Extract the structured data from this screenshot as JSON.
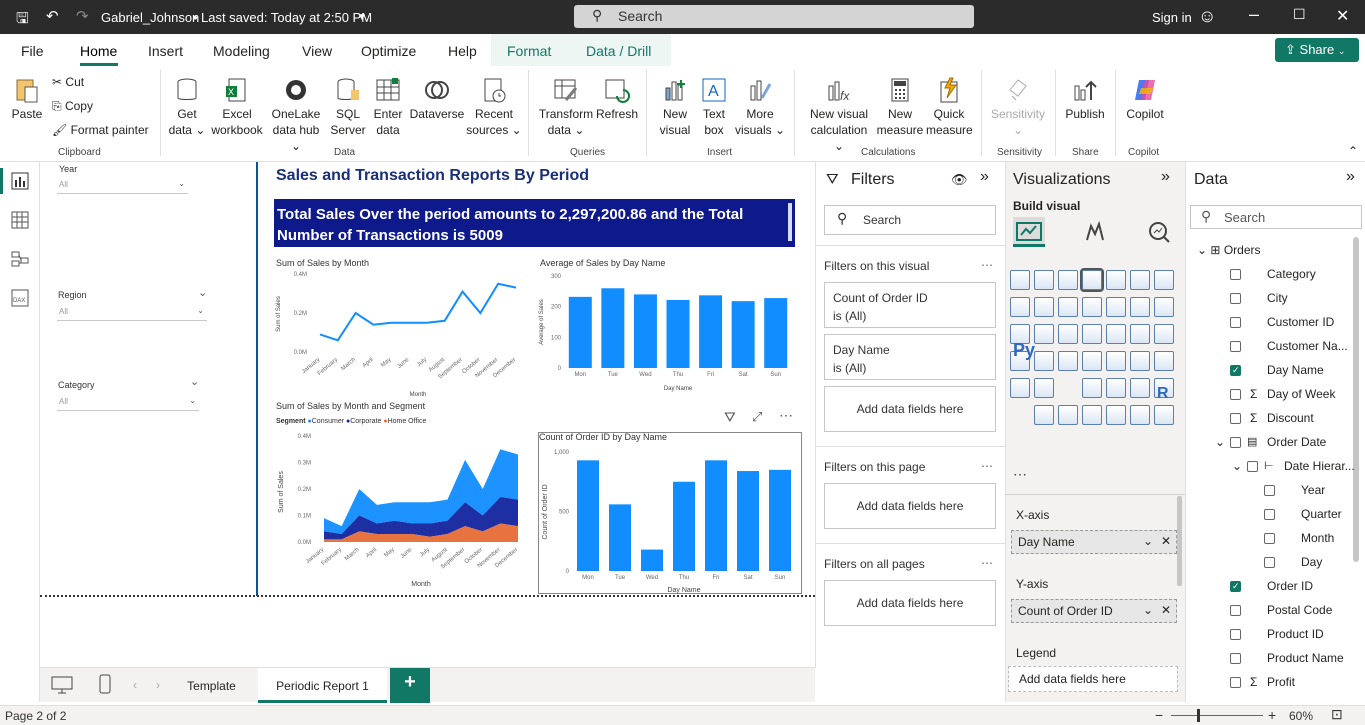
{
  "titlebar": {
    "file_name": "Gabriel_Johnson",
    "save_status": "Last saved: Today at 2:50 PM",
    "search_placeholder": "Search",
    "signin": "Sign in"
  },
  "menu": {
    "file": "File",
    "home": "Home",
    "insert": "Insert",
    "modeling": "Modeling",
    "view": "View",
    "optimize": "Optimize",
    "help": "Help",
    "format": "Format",
    "data_drill": "Data / Drill",
    "share": "Share"
  },
  "ribbon": {
    "paste": "Paste",
    "cut": "Cut",
    "copy": "Copy",
    "format_painter": "Format painter",
    "clipboard": "Clipboard",
    "get_data": [
      "Get",
      "data ⌄"
    ],
    "excel": [
      "Excel",
      "workbook"
    ],
    "onelake": [
      "OneLake",
      "data hub ⌄"
    ],
    "sql": [
      "SQL",
      "Server"
    ],
    "enter_data": [
      "Enter",
      "data"
    ],
    "dataverse": [
      "Dataverse"
    ],
    "recent": [
      "Recent",
      "sources ⌄"
    ],
    "data_group": "Data",
    "transform": [
      "Transform",
      "data ⌄"
    ],
    "refresh": [
      "Refresh"
    ],
    "queries": "Queries",
    "new_visual": [
      "New",
      "visual"
    ],
    "text_box": [
      "Text",
      "box"
    ],
    "more_visuals": [
      "More",
      "visuals ⌄"
    ],
    "insert_group": "Insert",
    "new_visual_calc": [
      "New visual",
      "calculation ⌄"
    ],
    "new_measure": [
      "New",
      "measure"
    ],
    "quick_measure": [
      "Quick",
      "measure"
    ],
    "calculations": "Calculations",
    "sensitivity": [
      "Sensitivity",
      "⌄"
    ],
    "sensitivity_group": "Sensitivity",
    "publish": [
      "Publish"
    ],
    "share_group": "Share",
    "copilot": [
      "Copilot"
    ],
    "copilot_group": "Copilot"
  },
  "slicers": {
    "year": "Year",
    "region": "Region",
    "category": "Category",
    "all": "All"
  },
  "report": {
    "title": "Sales and Transaction Reports By Period",
    "banner": "Total Sales Over the period amounts to 2,297,200.86 and the Total Number of Transactions is 5009",
    "c1_title": "Sum of Sales by Month",
    "c2_title": "Average of Sales by Day Name",
    "c3_title": "Sum of Sales by Month and Segment",
    "c4_title": "Count of Order ID by Day Name",
    "segment_label": "Segment",
    "legend": [
      "Consumer",
      "Corporate",
      "Home Office"
    ]
  },
  "chart_data": [
    {
      "type": "line",
      "title": "Sum of Sales by Month",
      "xlabel": "Month",
      "ylabel": "Sum of Sales",
      "categories": [
        "January",
        "February",
        "March",
        "April",
        "May",
        "June",
        "July",
        "August",
        "September",
        "October",
        "November",
        "December"
      ],
      "values": [
        0.09,
        0.06,
        0.2,
        0.14,
        0.15,
        0.15,
        0.15,
        0.16,
        0.31,
        0.2,
        0.35,
        0.33
      ],
      "yticks": [
        "0.0M",
        "0.2M",
        "0.4M"
      ],
      "ylim": [
        0,
        0.4
      ],
      "color": "#118dff"
    },
    {
      "type": "bar",
      "title": "Average of Sales by Day Name",
      "xlabel": "Day Name",
      "ylabel": "Average of Sales",
      "categories": [
        "Mon",
        "Tue",
        "Wed",
        "Thu",
        "Fri",
        "Sat",
        "Sun"
      ],
      "values": [
        232,
        260,
        240,
        222,
        237,
        218,
        228
      ],
      "yticks": [
        "0",
        "100",
        "200",
        "300"
      ],
      "ylim": [
        0,
        300
      ],
      "color": "#118dff"
    },
    {
      "type": "area",
      "title": "Sum of Sales by Month and Segment",
      "xlabel": "Month",
      "ylabel": "Sum of Sales",
      "categories": [
        "January",
        "February",
        "March",
        "April",
        "May",
        "June",
        "July",
        "August",
        "September",
        "October",
        "November",
        "December"
      ],
      "series": [
        {
          "name": "Consumer",
          "values": [
            0.05,
            0.03,
            0.1,
            0.07,
            0.07,
            0.08,
            0.08,
            0.08,
            0.16,
            0.1,
            0.18,
            0.17
          ]
        },
        {
          "name": "Corporate",
          "values": [
            0.03,
            0.02,
            0.06,
            0.04,
            0.05,
            0.04,
            0.05,
            0.05,
            0.09,
            0.06,
            0.1,
            0.1
          ]
        },
        {
          "name": "Home Office",
          "values": [
            0.01,
            0.01,
            0.04,
            0.03,
            0.03,
            0.03,
            0.02,
            0.03,
            0.06,
            0.04,
            0.07,
            0.06
          ]
        }
      ],
      "yticks": [
        "0.0M",
        "0.1M",
        "0.2M",
        "0.3M",
        "0.4M"
      ],
      "ylim": [
        0,
        0.4
      ]
    },
    {
      "type": "bar",
      "title": "Count of Order ID by Day Name",
      "xlabel": "Day Name",
      "ylabel": "Count of Order ID",
      "categories": [
        "Mon",
        "Tue",
        "Wed",
        "Thu",
        "Fri",
        "Sat",
        "Sun"
      ],
      "values": [
        930,
        560,
        180,
        750,
        930,
        840,
        850
      ],
      "yticks": [
        "0",
        "500",
        "1,000"
      ],
      "ylim": [
        0,
        1000
      ],
      "color": "#118dff"
    }
  ],
  "filters": {
    "title": "Filters",
    "search": "Search",
    "on_visual": "Filters on this visual",
    "f1": [
      "Count of Order ID",
      "is (All)"
    ],
    "f2": [
      "Day Name",
      "is (All)"
    ],
    "add": "Add data fields here",
    "on_page": "Filters on this page",
    "on_all": "Filters on all pages"
  },
  "viz": {
    "title": "Visualizations",
    "build": "Build visual",
    "xaxis": "X-axis",
    "xval": "Day Name",
    "yaxis": "Y-axis",
    "yval": "Count of Order ID",
    "legend": "Legend",
    "add": "Add data fields here",
    "py": "Py",
    "r": "R"
  },
  "data_pane": {
    "title": "Data",
    "search": "Search",
    "table": "Orders",
    "fields": [
      "Category",
      "City",
      "Customer ID",
      "Customer Na...",
      "Day Name",
      "Day of Week",
      "Discount",
      "Order Date",
      "Date Hierar...",
      "Year",
      "Quarter",
      "Month",
      "Day",
      "Order ID",
      "Postal Code",
      "Product ID",
      "Product Name",
      "Profit"
    ]
  },
  "tabs": {
    "template": "Template",
    "active": "Periodic Report 1",
    "add": "+"
  },
  "status": {
    "page": "Page 2 of 2",
    "zoom": "60%"
  }
}
